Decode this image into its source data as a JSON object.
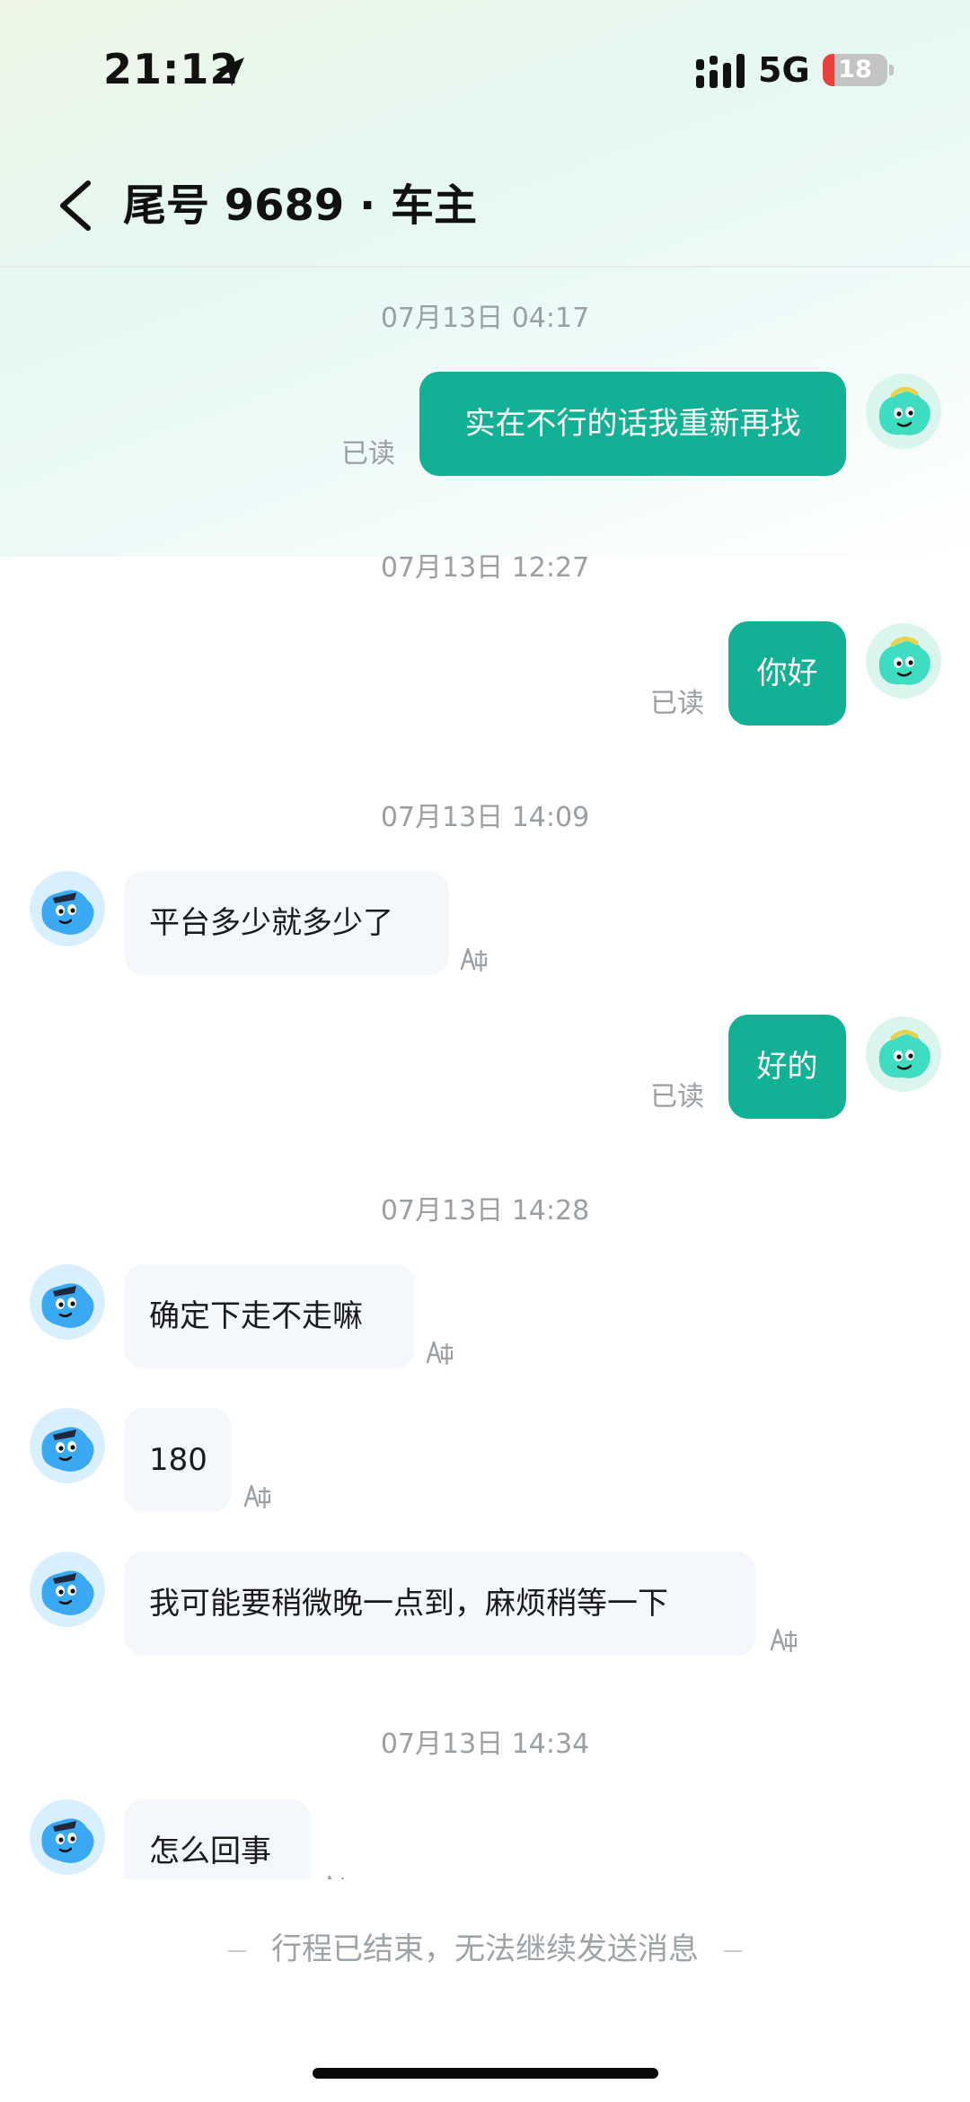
{
  "status_bar": {
    "time": "21:12",
    "network": "5G",
    "battery": "18",
    "battery_level": 0.18,
    "icons": [
      "location-arrow-icon",
      "cellular-signal-icon",
      "battery-icon"
    ]
  },
  "nav": {
    "title": "尾号 9689 · 车主",
    "back_icon": "chevron-left-icon"
  },
  "messages": [
    {
      "type": "time",
      "text": "07月13日 04:17"
    },
    {
      "type": "out",
      "text": "实在不行的话我重新再找",
      "status": "已读"
    },
    {
      "type": "time",
      "text": "07月13日 12:27"
    },
    {
      "type": "out",
      "text": "你好",
      "status": "已读"
    },
    {
      "type": "time",
      "text": "07月13日 14:09"
    },
    {
      "type": "in",
      "text": "平台多少就多少了",
      "icon": "translate-icon"
    },
    {
      "type": "out",
      "text": "好的",
      "status": "已读"
    },
    {
      "type": "time",
      "text": "07月13日 14:28"
    },
    {
      "type": "in",
      "text": "确定下走不走嘛",
      "icon": "translate-icon"
    },
    {
      "type": "in",
      "text": "180",
      "icon": "translate-icon"
    },
    {
      "type": "in",
      "text": "我可能要稍微晚一点到，麻烦稍等一下",
      "icon": "translate-icon"
    },
    {
      "type": "time",
      "text": "07月13日 14:34"
    },
    {
      "type": "in",
      "text": "怎么回事",
      "icon": "translate-icon"
    }
  ],
  "footer": {
    "notice": "行程已结束，无法继续发送消息"
  },
  "colors": {
    "outgoing_bubble": "#12b095",
    "incoming_bubble": "#f4f7fb",
    "driver_avatar": "#3aa8f2",
    "passenger_avatar": "#3edcc0"
  }
}
